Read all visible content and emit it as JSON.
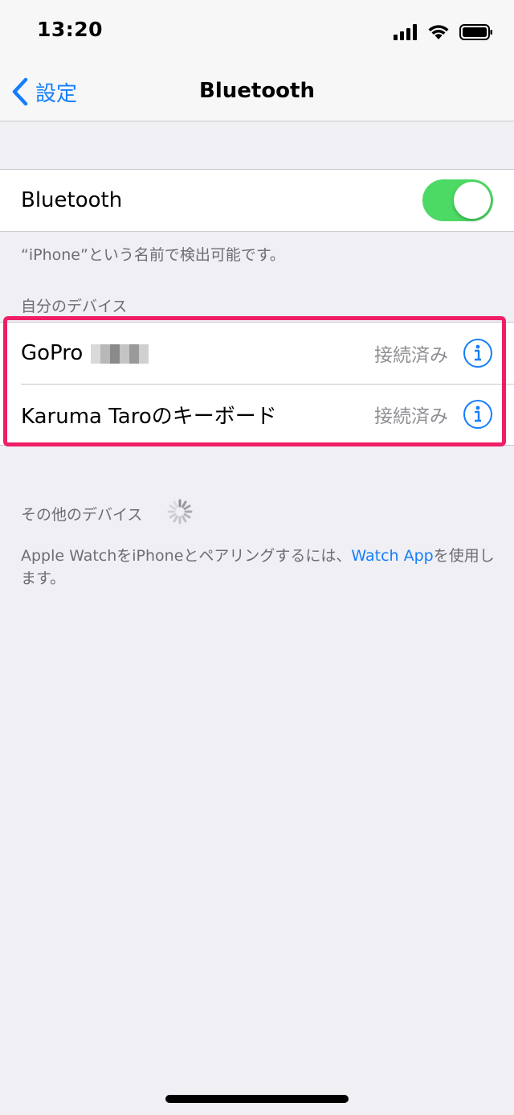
{
  "status_bar": {
    "time": "13:20"
  },
  "nav": {
    "back_label": "設定",
    "title": "Bluetooth"
  },
  "bluetooth_toggle": {
    "label": "Bluetooth",
    "enabled": true
  },
  "discoverable_caption": "“iPhone”という名前で検出可能です。",
  "my_devices": {
    "header": "自分のデバイス",
    "items": [
      {
        "name": "GoPro",
        "status": "接続済み"
      },
      {
        "name": "Karuma Taroのキーボード",
        "status": "接続済み"
      }
    ]
  },
  "other_devices": {
    "header": "その他のデバイス"
  },
  "watch_note": {
    "text_before": "Apple WatchをiPhoneとペアリングするには、",
    "link": "Watch App",
    "text_after": "を使用します。"
  },
  "colors": {
    "accent": "#157efb",
    "toggle_on": "#4cd964",
    "highlight": "#ef1f66"
  }
}
